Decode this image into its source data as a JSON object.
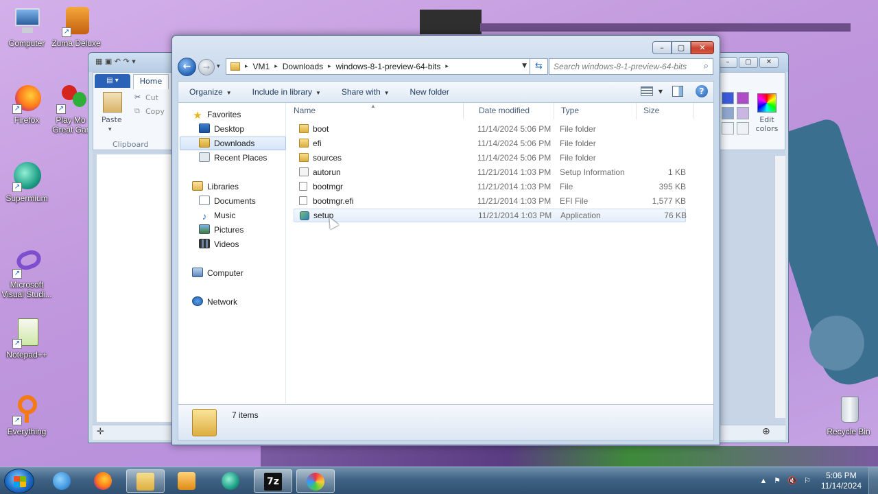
{
  "desktop": {
    "icons": [
      {
        "label": "Computer"
      },
      {
        "label": "Zuma Deluxe"
      },
      {
        "label": "Firefox"
      },
      {
        "label": "Play Mo Great Gar"
      },
      {
        "label": "Supermium"
      },
      {
        "label": "Microsoft Visual Studi..."
      },
      {
        "label": "Notepad++"
      },
      {
        "label": "Everything"
      },
      {
        "label": "Recycle Bin"
      }
    ]
  },
  "paint": {
    "home_tab": "Home",
    "paste_label": "Paste",
    "cut_label": "Cut",
    "copy_label": "Copy",
    "clipboard_group": "Clipboard",
    "edit_colors_label": "Edit colors",
    "colors": [
      "#3b5bdb",
      "#b04bc8",
      "#8fa7cf",
      "#c9b6e3"
    ]
  },
  "explorer": {
    "breadcrumb": [
      "VM1",
      "Downloads",
      "windows-8-1-preview-64-bits"
    ],
    "search_placeholder": "Search windows-8-1-preview-64-bits",
    "toolbar": {
      "organize": "Organize",
      "include_in_library": "Include in library",
      "share_with": "Share with",
      "new_folder": "New folder"
    },
    "nav": {
      "favorites": "Favorites",
      "desktop": "Desktop",
      "downloads": "Downloads",
      "recent_places": "Recent Places",
      "libraries": "Libraries",
      "documents": "Documents",
      "music": "Music",
      "pictures": "Pictures",
      "videos": "Videos",
      "computer": "Computer",
      "network": "Network"
    },
    "columns": {
      "name": "Name",
      "date_modified": "Date modified",
      "type": "Type",
      "size": "Size"
    },
    "files": [
      {
        "name": "boot",
        "date": "11/14/2024 5:06 PM",
        "type": "File folder",
        "size": "",
        "icon": "folder-icon"
      },
      {
        "name": "efi",
        "date": "11/14/2024 5:06 PM",
        "type": "File folder",
        "size": "",
        "icon": "folder-icon"
      },
      {
        "name": "sources",
        "date": "11/14/2024 5:06 PM",
        "type": "File folder",
        "size": "",
        "icon": "folder-icon"
      },
      {
        "name": "autorun",
        "date": "11/21/2014 1:03 PM",
        "type": "Setup Information",
        "size": "1 KB",
        "icon": "setup-info-icon"
      },
      {
        "name": "bootmgr",
        "date": "11/21/2014 1:03 PM",
        "type": "File",
        "size": "395 KB",
        "icon": "file-icon"
      },
      {
        "name": "bootmgr.efi",
        "date": "11/21/2014 1:03 PM",
        "type": "EFI File",
        "size": "1,577 KB",
        "icon": "file-icon"
      },
      {
        "name": "setup",
        "date": "11/21/2014 1:03 PM",
        "type": "Application",
        "size": "76 KB",
        "icon": "application-icon"
      }
    ],
    "item_count": "7 items"
  },
  "taskbar": {
    "time": "5:06 PM",
    "date": "11/14/2024"
  }
}
